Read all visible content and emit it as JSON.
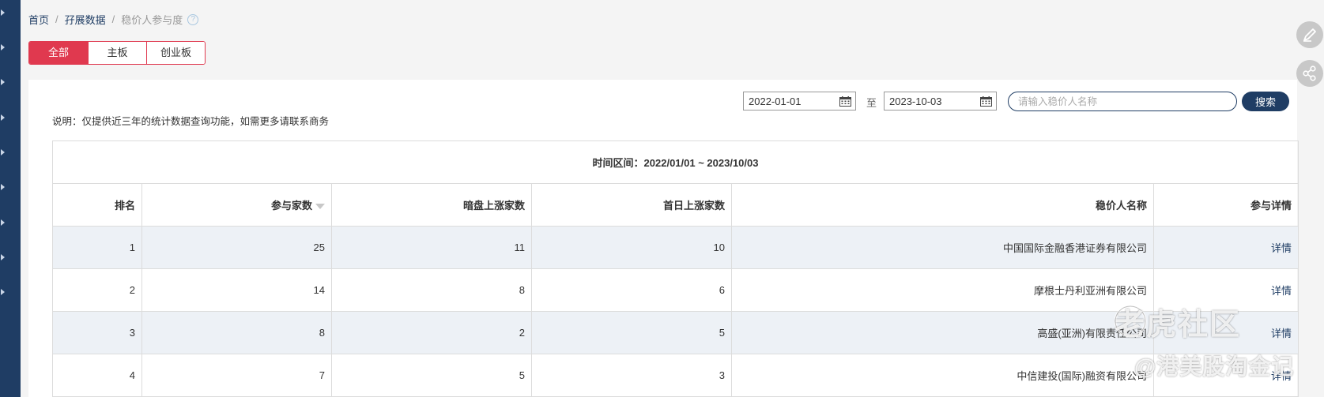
{
  "breadcrumb": {
    "home": "首页",
    "section": "孖展数据",
    "current": "稳价人参与度"
  },
  "tabs": [
    {
      "label": "全部",
      "active": true
    },
    {
      "label": "主板",
      "active": false
    },
    {
      "label": "创业板",
      "active": false
    }
  ],
  "note": "说明：仅提供近三年的统计数据查询功能，如需更多请联系商务",
  "filters": {
    "start_date": "2022-01-01",
    "to_label": "至",
    "end_date": "2023-10-03",
    "search_placeholder": "请输入稳价人名称",
    "search_label": "搜索"
  },
  "table": {
    "range_title": "时间区间：2022/01/01 ~ 2023/10/03",
    "columns": [
      "排名",
      "参与家数",
      "暗盘上涨家数",
      "首日上涨家数",
      "稳价人名称",
      "参与详情"
    ],
    "rows": [
      {
        "rank": "1",
        "count": "25",
        "dark_up": "11",
        "first_day_up": "10",
        "name": "中国国际金融香港证券有限公司",
        "detail": "详情"
      },
      {
        "rank": "2",
        "count": "14",
        "dark_up": "8",
        "first_day_up": "6",
        "name": "摩根士丹利亚洲有限公司",
        "detail": "详情"
      },
      {
        "rank": "3",
        "count": "8",
        "dark_up": "2",
        "first_day_up": "5",
        "name": "高盛(亚洲)有限责任公司",
        "detail": "详情"
      },
      {
        "rank": "4",
        "count": "7",
        "dark_up": "5",
        "first_day_up": "3",
        "name": "中信建投(国际)融资有限公司",
        "detail": "详情"
      }
    ]
  },
  "watermark": {
    "line1": "老虎社区",
    "line2": "@港美股淘金记"
  },
  "colors": {
    "accent": "#e0394f",
    "brand": "#1f3d64",
    "row_alt": "#edf1f6"
  }
}
